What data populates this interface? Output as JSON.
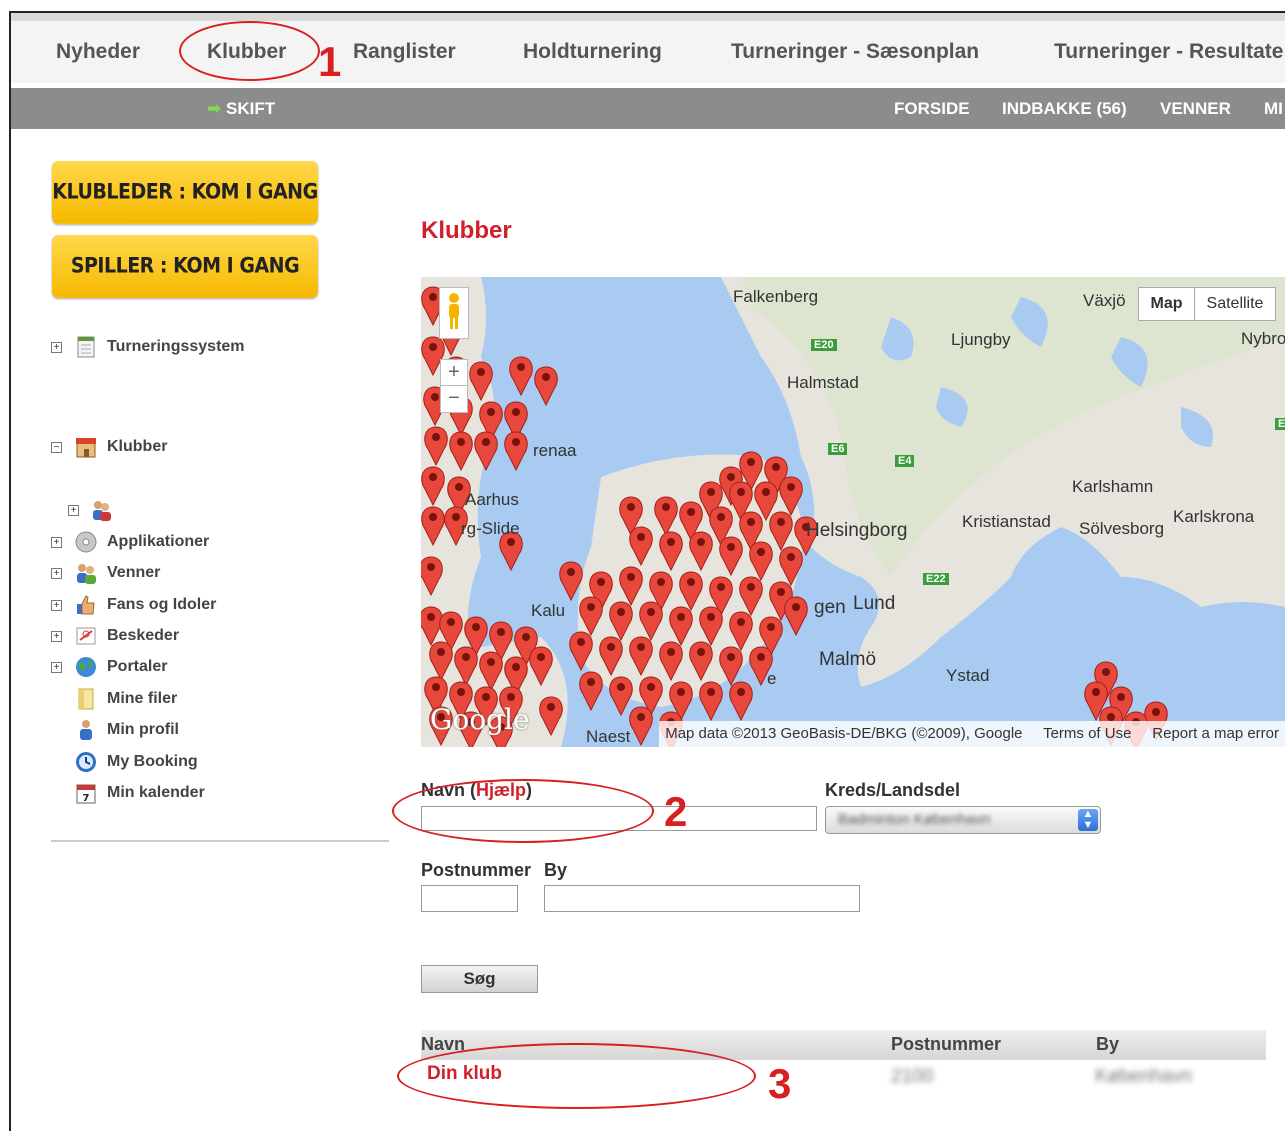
{
  "top_nav": {
    "items": [
      "Nyheder",
      "Klubber",
      "Ranglister",
      "Holdturnering",
      "Turneringer - Sæsonplan",
      "Turneringer - Resultate"
    ]
  },
  "sub_nav": {
    "skift": "SKIFT",
    "links": [
      "FORSIDE",
      "INDBAKKE (56)",
      "VENNER",
      "MI"
    ]
  },
  "sidebar": {
    "btn_klubleder": "KLUBLEDER :  KOM I GANG",
    "btn_spiller": "SPILLER :  KOM I GANG",
    "tree": [
      {
        "label": "Turneringssystem",
        "toggle": "+",
        "icon": "calendar-sheet-icon"
      },
      {
        "label": "Klubber",
        "toggle": "−",
        "icon": "club-building-icon"
      },
      {
        "label": "",
        "toggle": "+",
        "icon": "people-icon"
      },
      {
        "label": "Applikationer",
        "toggle": "+",
        "icon": "cd-icon"
      },
      {
        "label": "Venner",
        "toggle": "+",
        "icon": "friends-icon"
      },
      {
        "label": "Fans og Idoler",
        "toggle": "+",
        "icon": "thumbs-up-icon"
      },
      {
        "label": "Beskeder",
        "toggle": "+",
        "icon": "message-icon"
      },
      {
        "label": "Portaler",
        "toggle": "+",
        "icon": "globe-icon"
      },
      {
        "label": "Mine filer",
        "toggle": "",
        "icon": "folder-icon"
      },
      {
        "label": "Min profil",
        "toggle": "",
        "icon": "profile-icon"
      },
      {
        "label": "My Booking",
        "toggle": "",
        "icon": "clock-icon"
      },
      {
        "label": "Min kalender",
        "toggle": "",
        "icon": "calendar-icon"
      }
    ]
  },
  "main": {
    "heading": "Klubber",
    "map": {
      "map_btn": "Map",
      "satellite_btn": "Satellite",
      "zoom_in": "+",
      "zoom_out": "−",
      "labels": [
        "Falkenberg",
        "Växjö",
        "Nybro",
        "Ljungby",
        "Halmstad",
        "Karlshamn",
        "Kristianstad",
        "Sölvesborg",
        "Karlskrona",
        "Helsingborg",
        "Lund",
        "Malmö",
        "Ystad",
        "renaa",
        "Aarhus",
        "rg-Slide",
        "Kalu",
        "gen",
        "e",
        "Naest"
      ],
      "roads": [
        "E20",
        "E6",
        "E4",
        "E22",
        "E"
      ],
      "logo": "Google",
      "attribution": "Map data ©2013 GeoBasis-DE/BKG (©2009), Google",
      "terms": "Terms of Use",
      "report": "Report a map error"
    },
    "form": {
      "navn_label": "Navn",
      "hjaelp_open": "(",
      "hjaelp": "Hjælp",
      "hjaelp_close": ")",
      "kreds_label": "Kreds/Landsdel",
      "kreds_value": "Badminton København",
      "postnummer_label": "Postnummer",
      "by_label": "By",
      "search_button": "Søg"
    },
    "results": {
      "headers": [
        "Navn",
        "Postnummer",
        "By"
      ],
      "rows": [
        {
          "navn": "Din klub",
          "postnummer": "2100",
          "by": "København"
        }
      ]
    }
  },
  "annotations": [
    "1",
    "2",
    "3"
  ],
  "colors": {
    "accent_red": "#d0202c",
    "nav_gray": "#8c8c8c",
    "button_yellow": "#f6b800",
    "annotation_red": "#d82020"
  }
}
